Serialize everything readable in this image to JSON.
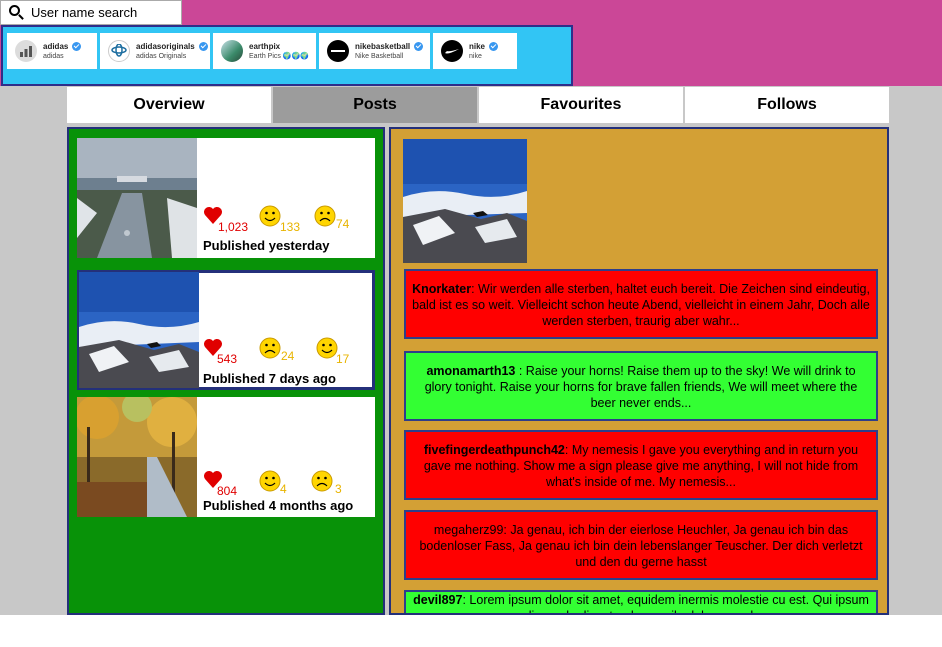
{
  "search": {
    "placeholder": "User name search",
    "icon": "search-icon"
  },
  "suggestions": [
    {
      "name": "adidas",
      "subtitle": "adidas",
      "verified": true,
      "avatar_color": "#888888"
    },
    {
      "name": "adidasoriginals",
      "subtitle": "adidas Originals",
      "verified": true,
      "avatar_color": "#1e6ea0"
    },
    {
      "name": "earthpix",
      "subtitle": "Earth Pics 🌍🌍🌍",
      "verified": false,
      "avatar_color": "#3a8a6a"
    },
    {
      "name": "nikebasketball",
      "subtitle": "Nike Basketball",
      "verified": true,
      "avatar_color": "#000000"
    },
    {
      "name": "nike",
      "subtitle": "nike",
      "verified": true,
      "avatar_color": "#000000"
    }
  ],
  "tabs": [
    {
      "label": "Overview",
      "active": false
    },
    {
      "label": "Posts",
      "active": true
    },
    {
      "label": "Favourites",
      "active": false
    },
    {
      "label": "Follows",
      "active": false
    }
  ],
  "posts": [
    {
      "likes": "1,023",
      "happy": "133",
      "sad": "74",
      "published": "Published yesterday",
      "image": "lake-snow-photo",
      "selected": false
    },
    {
      "likes": "543",
      "happy": "17",
      "sad": "24",
      "published": "Published 7 days ago",
      "image": "mountain-clouds-photo",
      "selected": true
    },
    {
      "likes": "804",
      "happy": "4",
      "sad": "3",
      "published": "Published 4 months ago",
      "image": "autumn-path-photo",
      "selected": false
    }
  ],
  "detail": {
    "image": "mountain-clouds-photo",
    "comments": [
      {
        "user": "Knorkater",
        "text": ": Wir werden alle sterben, haltet euch bereit. Die Zeichen sind eindeutig, bald ist es so weit. Vielleicht schon heute Abend, vielleicht in einem Jahr, Doch alle werden sterben, traurig aber wahr...",
        "color": "red",
        "bold": true
      },
      {
        "user": "amonamarth13",
        "text": " : Raise your horns! Raise them up to the sky! We will drink to glory tonight. Raise your horns for brave fallen friends, We will meet where the beer never ends...",
        "color": "green",
        "bold": true
      },
      {
        "user": "fivefingerdeathpunch42",
        "text": ": My nemesis I gave you everything and in return you gave me nothing. Show me a sign please give me anything, I will not hide from what's inside of me. My nemesis...",
        "color": "red",
        "bold": true
      },
      {
        "user": "megaherz99",
        "text": ": Ja genau, ich bin der eierlose Heuchler, Ja genau ich bin das bodenloser Fass, Ja genau ich bin dein lebenslanger Teuscher. Der dich verletzt und den du gerne hasst",
        "color": "red",
        "bold": false
      },
      {
        "user": "devil897",
        "text": ": Lorem ipsum dolor sit amet, equidem inermis molestie cu est. Qui ipsum aliquando disputando eu, cibo labore cu du",
        "color": "green",
        "bold": true
      }
    ]
  },
  "colors": {
    "topband": "#cb4797",
    "suggestbar": "#32c5f4",
    "leftpanel": "#089208",
    "rightpanel": "#d3a035",
    "heart": "#e00000",
    "emoji": "#ffd500"
  }
}
